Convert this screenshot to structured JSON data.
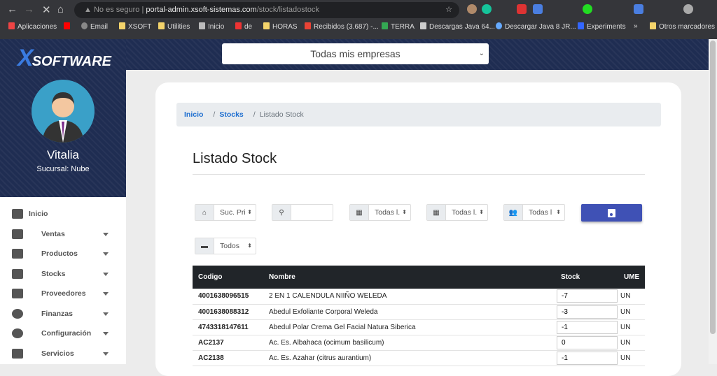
{
  "browser": {
    "security": "No es seguro",
    "url_host": "portal-admin.xsoft-sistemas.com",
    "url_path": "/stock/listadostock",
    "bookmarks": [
      "Aplicaciones",
      "Email",
      "XSOFT",
      "Utilities",
      "Inicio",
      "de",
      "HORAS",
      "Recibidos (3.687) -...",
      "TERRA",
      "Descargas Java 64...",
      "Descargar Java 8 JR...",
      "Experiments",
      "»",
      "Otros marcadores"
    ]
  },
  "sidebar": {
    "logo": "SOFTWARE",
    "logo_x": "X",
    "user": "Vitalia",
    "branch": "Sucursal: Nube",
    "items": [
      {
        "label": "Inicio",
        "icon": "home-icon"
      },
      {
        "label": "Ventas",
        "icon": "cart-icon"
      },
      {
        "label": "Productos",
        "icon": "tag-icon"
      },
      {
        "label": "Stocks",
        "icon": "truck-icon"
      },
      {
        "label": "Proveedores",
        "icon": "clipboard-user-icon"
      },
      {
        "label": "Finanzas",
        "icon": "dollar-icon"
      },
      {
        "label": "Configuración",
        "icon": "gear-icon"
      },
      {
        "label": "Servicios",
        "icon": "laptop-icon"
      }
    ]
  },
  "header": {
    "company_select": "Todas mis empresas"
  },
  "breadcrumb": {
    "home": "Inicio",
    "stocks": "Stocks",
    "current": "Listado Stock"
  },
  "page_title": "Listado Stock",
  "filters": {
    "branch": "Suc. Pri",
    "search_placeholder": "",
    "f2": "Todas l.",
    "f3": "Todas l.",
    "f4": "Todas l",
    "f5": "Todos"
  },
  "accent": "#3f51b5",
  "table": {
    "headers": [
      "Codigo",
      "Nombre",
      "Stock",
      "UME"
    ],
    "rows": [
      [
        "4001638096515",
        "2 EN 1 CALENDULA NIIÑO WELEDA",
        "-7",
        "UN"
      ],
      [
        "4001638088312",
        "Abedul Exfoliante Corporal Weleda",
        "-3",
        "UN"
      ],
      [
        "4743318147611",
        "Abedul Polar Crema Gel Facial Natura Siberica",
        "-1",
        "UN"
      ],
      [
        "AC2137",
        "Ac. Es. Albahaca (ocimum basilicum)",
        "0",
        "UN"
      ],
      [
        "AC2138",
        "Ac. Es. Azahar (citrus aurantium)",
        "-1",
        "UN"
      ]
    ]
  }
}
